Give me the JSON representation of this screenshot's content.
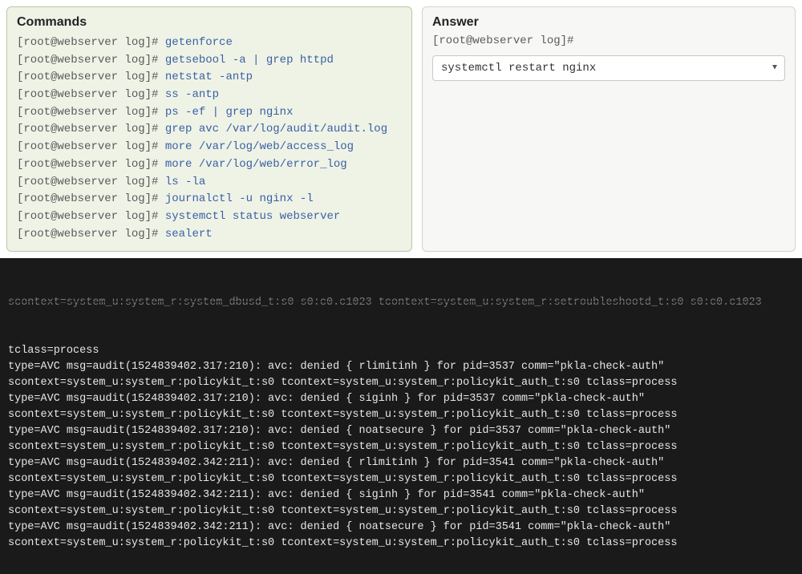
{
  "commands": {
    "title": "Commands",
    "prompt": "[root@webserver log]#",
    "items": [
      "getenforce",
      "getsebool -a | grep httpd",
      "netstat -antp",
      "ss -antp",
      "ps -ef | grep nginx",
      "grep avc /var/log/audit/audit.log",
      "more /var/log/web/access_log",
      "more /var/log/web/error_log",
      "ls -la",
      "journalctl -u nginx -l",
      "systemctl status webserver",
      "sealert"
    ]
  },
  "answer": {
    "title": "Answer",
    "prompt": "[root@webserver log]#",
    "selected": "systemctl restart nginx"
  },
  "terminal": {
    "truncated_top": "scontext=system_u:system_r:system_dbusd_t:s0-s0:c0.c1023 tcontext=system_u:system_r:setroubleshootd_t:s0-s0:c0.c1023",
    "lines": [
      "tclass=process",
      "type=AVC msg=audit(1524839402.317:210): avc: denied { rlimitinh } for pid=3537 comm=\"pkla-check-auth\"",
      "scontext=system_u:system_r:policykit_t:s0 tcontext=system_u:system_r:policykit_auth_t:s0 tclass=process",
      "type=AVC msg=audit(1524839402.317:210): avc: denied { siginh } for pid=3537 comm=\"pkla-check-auth\"",
      "scontext=system_u:system_r:policykit_t:s0 tcontext=system_u:system_r:policykit_auth_t:s0 tclass=process",
      "type=AVC msg=audit(1524839402.317:210): avc: denied { noatsecure } for pid=3537 comm=\"pkla-check-auth\"",
      "scontext=system_u:system_r:policykit_t:s0 tcontext=system_u:system_r:policykit_auth_t:s0 tclass=process",
      "type=AVC msg=audit(1524839402.342:211): avc: denied { rlimitinh } for pid=3541 comm=\"pkla-check-auth\"",
      "scontext=system_u:system_r:policykit_t:s0 tcontext=system_u:system_r:policykit_auth_t:s0 tclass=process",
      "type=AVC msg=audit(1524839402.342:211): avc: denied { siginh } for pid=3541 comm=\"pkla-check-auth\"",
      "scontext=system_u:system_r:policykit_t:s0 tcontext=system_u:system_r:policykit_auth_t:s0 tclass=process",
      "type=AVC msg=audit(1524839402.342:211): avc: denied { noatsecure } for pid=3541 comm=\"pkla-check-auth\"",
      "scontext=system_u:system_r:policykit_t:s0 tcontext=system_u:system_r:policykit_auth_t:s0 tclass=process"
    ]
  }
}
